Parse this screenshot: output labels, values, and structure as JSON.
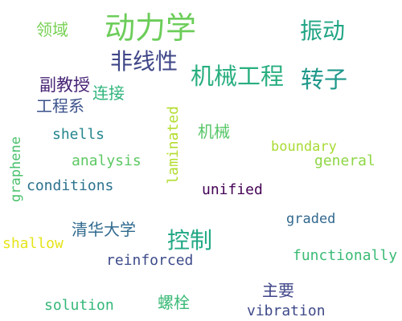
{
  "words": [
    {
      "text": "动力学",
      "color": "#6ccd5a"
    },
    {
      "text": "振动",
      "color": "#21a585"
    },
    {
      "text": "领域",
      "color": "#77d153"
    },
    {
      "text": "非线性",
      "color": "#3f4788"
    },
    {
      "text": "机械工程",
      "color": "#29af7f"
    },
    {
      "text": "转子",
      "color": "#1f988b"
    },
    {
      "text": "副教授",
      "color": "#482576"
    },
    {
      "text": "连接",
      "color": "#2fb47c"
    },
    {
      "text": "工程系",
      "color": "#3b528b"
    },
    {
      "text": "shells",
      "color": "#25858e"
    },
    {
      "text": "laminated",
      "color": "#b2dd2d"
    },
    {
      "text": "机械",
      "color": "#56c667"
    },
    {
      "text": "boundary",
      "color": "#a8db34"
    },
    {
      "text": "graphene",
      "color": "#4ac16d"
    },
    {
      "text": "analysis",
      "color": "#5cc863"
    },
    {
      "text": "general",
      "color": "#8ed645"
    },
    {
      "text": "conditions",
      "color": "#2c728e"
    },
    {
      "text": "unified",
      "color": "#440154"
    },
    {
      "text": "清华大学",
      "color": "#306a8e"
    },
    {
      "text": "graded",
      "color": "#31688e"
    },
    {
      "text": "shallow",
      "color": "#e5e419"
    },
    {
      "text": "控制",
      "color": "#22a884"
    },
    {
      "text": "reinforced",
      "color": "#3e4c8a"
    },
    {
      "text": "functionally",
      "color": "#3bbb75"
    },
    {
      "text": "主要",
      "color": "#404688"
    },
    {
      "text": "solution",
      "color": "#35b779"
    },
    {
      "text": "螺栓",
      "color": "#3aba76"
    },
    {
      "text": "vibration",
      "color": "#3e4989"
    }
  ]
}
